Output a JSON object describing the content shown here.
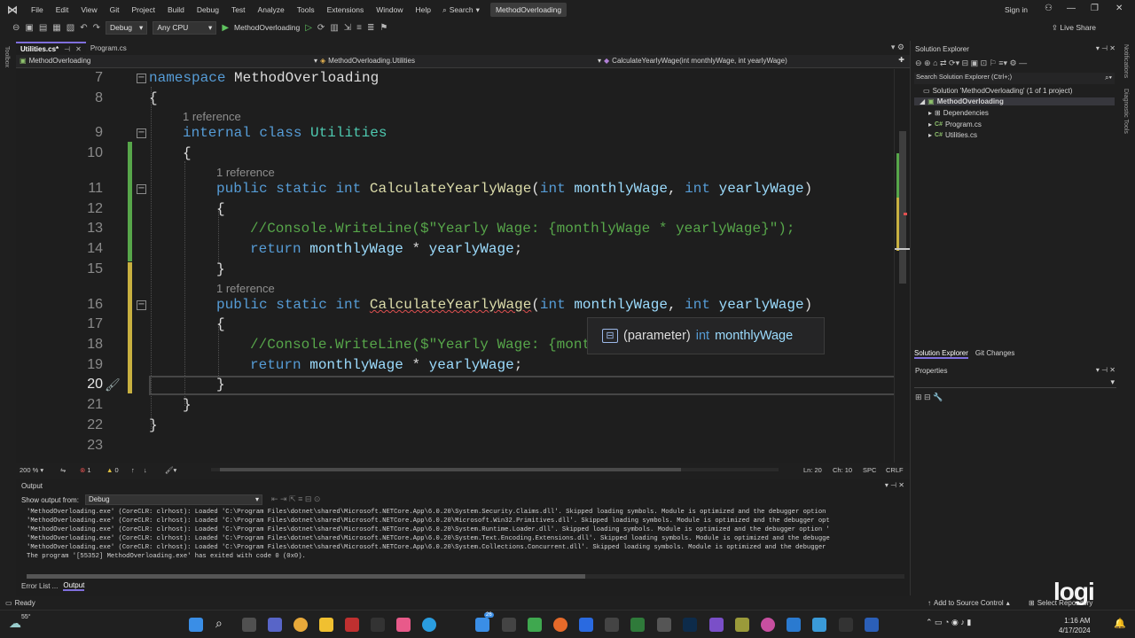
{
  "menubar": {
    "logo": "VS",
    "items": [
      "File",
      "Edit",
      "View",
      "Git",
      "Project",
      "Build",
      "Debug",
      "Test",
      "Analyze",
      "Tools",
      "Extensions",
      "Window",
      "Help"
    ],
    "search": "Search",
    "title": "MethodOverloading",
    "signin": "Sign in"
  },
  "toolbar": {
    "config": "Debug",
    "platform": "Any CPU",
    "run_target": "MethodOverloading",
    "live_share": "Live Share"
  },
  "left_strip": "Toolbox",
  "tabs": [
    {
      "label": "Utilities.cs*",
      "active": true
    },
    {
      "label": "Program.cs",
      "active": false
    }
  ],
  "navbar": {
    "project": "MethodOverloading",
    "type": "MethodOverloading.Utilities",
    "member": "CalculateYearlyWage(int monthlyWage, int yearlyWage)"
  },
  "editor": {
    "line_numbers": [
      "7",
      "8",
      "9",
      "10",
      "11",
      "12",
      "13",
      "14",
      "15",
      "16",
      "17",
      "18",
      "19",
      "20",
      "21",
      "22",
      "23"
    ],
    "ref_label": "1 reference",
    "code": {
      "l7_kw": "namespace",
      "l7_name": "MethodOverloading",
      "open_brace": "{",
      "close_brace": "}",
      "l9_kw1": "internal",
      "l9_kw2": "class",
      "l9_name": "Utilities",
      "kw_public": "public",
      "kw_static": "static",
      "kw_int": "int",
      "method": "CalculateYearlyWage",
      "p1": "monthlyWage",
      "p2": "yearlyWage",
      "comment": "//Console.WriteLine($\"Yearly Wage: {monthlyWage * yearlyWage}\");",
      "comment_partial": "//Console.WriteLine($\"Yearly Wage: {mont",
      "kw_return": "return",
      "op": "*",
      "semi": ";",
      "lparen": "(",
      "rparen": ")",
      "comma": ","
    },
    "tooltip": {
      "prefix": "(parameter)",
      "type": "int",
      "name": "monthlyWage"
    }
  },
  "editor_status": {
    "zoom": "200 %",
    "errors": "1",
    "warnings": "0",
    "line": "Ln: 20",
    "col": "Ch: 10",
    "spacing": "SPC",
    "eol": "CRLF"
  },
  "output": {
    "title": "Output",
    "show_from_label": "Show output from:",
    "show_from_value": "Debug",
    "lines": [
      "'MethodOverloading.exe' (CoreCLR: clrhost): Loaded 'C:\\Program Files\\dotnet\\shared\\Microsoft.NETCore.App\\6.0.20\\System.Security.Claims.dll'. Skipped loading symbols. Module is optimized and the debugger option",
      "'MethodOverloading.exe' (CoreCLR: clrhost): Loaded 'C:\\Program Files\\dotnet\\shared\\Microsoft.NETCore.App\\6.0.20\\Microsoft.Win32.Primitives.dll'. Skipped loading symbols. Module is optimized and the debugger opt",
      "'MethodOverloading.exe' (CoreCLR: clrhost): Loaded 'C:\\Program Files\\dotnet\\shared\\Microsoft.NETCore.App\\6.0.20\\System.Runtime.Loader.dll'. Skipped loading symbols. Module is optimized and the debugger option '",
      "'MethodOverloading.exe' (CoreCLR: clrhost): Loaded 'C:\\Program Files\\dotnet\\shared\\Microsoft.NETCore.App\\6.0.20\\System.Text.Encoding.Extensions.dll'. Skipped loading symbols. Module is optimized and the debugge",
      "'MethodOverloading.exe' (CoreCLR: clrhost): Loaded 'C:\\Program Files\\dotnet\\shared\\Microsoft.NETCore.App\\6.0.20\\System.Collections.Concurrent.dll'. Skipped loading symbols. Module is optimized and the debugger",
      "The program '[55352] MethodOverloading.exe' has exited with code 0 (0x0)."
    ],
    "tabs": [
      "Error List ...",
      "Output"
    ]
  },
  "solution_explorer": {
    "title": "Solution Explorer",
    "search_placeholder": "Search Solution Explorer (Ctrl+;)",
    "solution": "Solution 'MethodOverloading' (1 of 1 project)",
    "project": "MethodOverloading",
    "items": [
      "Dependencies",
      "Program.cs",
      "Utilities.cs"
    ],
    "bottom_tabs": [
      "Solution Explorer",
      "Git Changes"
    ],
    "cs_badge": "C#"
  },
  "properties": {
    "title": "Properties"
  },
  "right_strip": [
    "Notifications",
    "Diagnostic Tools"
  ],
  "statusbar": {
    "ready": "Ready",
    "source_control": "Add to Source Control",
    "repo": "Select Repository"
  },
  "watermark": "logi",
  "taskbar": {
    "weather": "55°",
    "badge": "26",
    "time": "1:16 AM",
    "date": "4/17/2024"
  },
  "colors": {
    "keyword": "#569cd6",
    "type": "#4ec9b0",
    "method": "#dcdcaa",
    "parameter": "#9cdcfe",
    "comment": "#57a64a",
    "accent": "#7f6fdc"
  }
}
